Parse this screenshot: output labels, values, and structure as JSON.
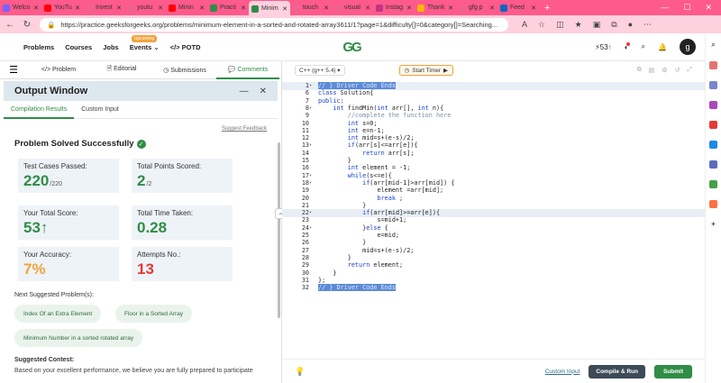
{
  "browser": {
    "tabs": [
      {
        "label": "Welco",
        "color": "#7b61ff"
      },
      {
        "label": "YouTu",
        "color": "#ff0000"
      },
      {
        "label": "Invest",
        "color": "#f06292"
      },
      {
        "label": "youtu",
        "color": "#f06292"
      },
      {
        "label": "Minin",
        "color": "#ff0000"
      },
      {
        "label": "Practi",
        "color": "#2f8d46"
      },
      {
        "label": "Minim",
        "color": "#2f8d46"
      },
      {
        "label": "touch",
        "color": "#f06292"
      },
      {
        "label": "visual",
        "color": "#f06292"
      },
      {
        "label": "Instag",
        "color": "#c13584"
      },
      {
        "label": "Thank",
        "color": "#ffb300"
      },
      {
        "label": "gfg p",
        "color": "#f06292"
      },
      {
        "label": "Feed",
        "color": "#0a66c2"
      }
    ],
    "active_tab": 6,
    "url": "https://practice.geeksforgeeks.org/problems/minimum-element-in-a-sorted-and-rotated-array3611/1?page=1&difficulty[]=0&category[]=Searching..."
  },
  "header": {
    "nav": [
      "Problems",
      "Courses",
      "Jobs",
      "Events",
      "POTD"
    ],
    "events_badge": "Upcoming",
    "logo": "GG",
    "streak": "53",
    "avatar": "g"
  },
  "problem_tabs": [
    "Problem",
    "Editorial",
    "Submissions",
    "Comments"
  ],
  "output": {
    "title": "Output Window",
    "tabs": [
      "Compilation Results",
      "Custom Input"
    ],
    "suggest_feedback": "Suggest Feedback",
    "status": "Problem Solved Successfully",
    "cards": [
      {
        "label": "Test Cases Passed:",
        "value": "220",
        "suffix": "/220",
        "color": "#2f8d46"
      },
      {
        "label": "Total Points Scored:",
        "value": "2",
        "suffix": "/2",
        "color": "#2f8d46"
      },
      {
        "label": "Your Total Score:",
        "value": "53",
        "suffix": "",
        "color": "#2f8d46"
      },
      {
        "label": "Total Time Taken:",
        "value": "0.28",
        "suffix": "",
        "color": "#2f8d46"
      },
      {
        "label": "Your Accuracy:",
        "value": "7%",
        "suffix": "",
        "color": "#f0a23b"
      },
      {
        "label": "Attempts No.:",
        "value": "13",
        "suffix": "",
        "color": "#e53935"
      }
    ],
    "next_suggested": "Next Suggested Problem(s):",
    "suggestions": [
      "Index Of an Extra Element",
      "Floor in a Sorted Array",
      "Minimum Number in a sorted rotated array"
    ],
    "suggested_contest": "Suggested Contest:",
    "contest_text": "Based on your excellent performance, we believe you are fully prepared to participate"
  },
  "editor": {
    "language": "C++ (g++ 5.4)",
    "timer": "Start Timer",
    "lines": [
      "// } Driver Code Ends",
      "class Solution{",
      "public:",
      "    int findMin(int arr[], int n){",
      "        //complete the function here",
      "        int s=0;",
      "        int e=n-1;",
      "        int mid=s+(e-s)/2;",
      "        if(arr[s]<=arr[e]){",
      "            return arr[s];",
      "        }",
      "        int element = -1;",
      "        while(s<=e){",
      "            if(arr[mid-1]>arr[mid]) {",
      "                element =arr[mid];",
      "                break ;",
      "            }",
      "            if(arr[mid]>=arr[e]){",
      "                s=mid+1;",
      "            }else {",
      "                e=mid;",
      "            }",
      "            mid=s+(e-s)/2;",
      "        }",
      "        return element;",
      "    }",
      "};",
      "// } Driver Code Ends"
    ],
    "line_numbers": [
      "1",
      "6",
      "7",
      "8",
      "9",
      "10",
      "11",
      "12",
      "13",
      "14",
      "15",
      "16",
      "17",
      "18",
      "19",
      "20",
      "21",
      "22",
      "23",
      "24",
      "25",
      "26",
      "27",
      "28",
      "29",
      "30",
      "31",
      "32"
    ],
    "fold_lines": [
      0,
      3,
      8,
      12,
      13,
      17,
      19
    ],
    "highlight_lines": [
      0,
      17
    ],
    "custom_input": "Custom Input",
    "compile_run": "Compile & Run",
    "submit": "Submit"
  }
}
